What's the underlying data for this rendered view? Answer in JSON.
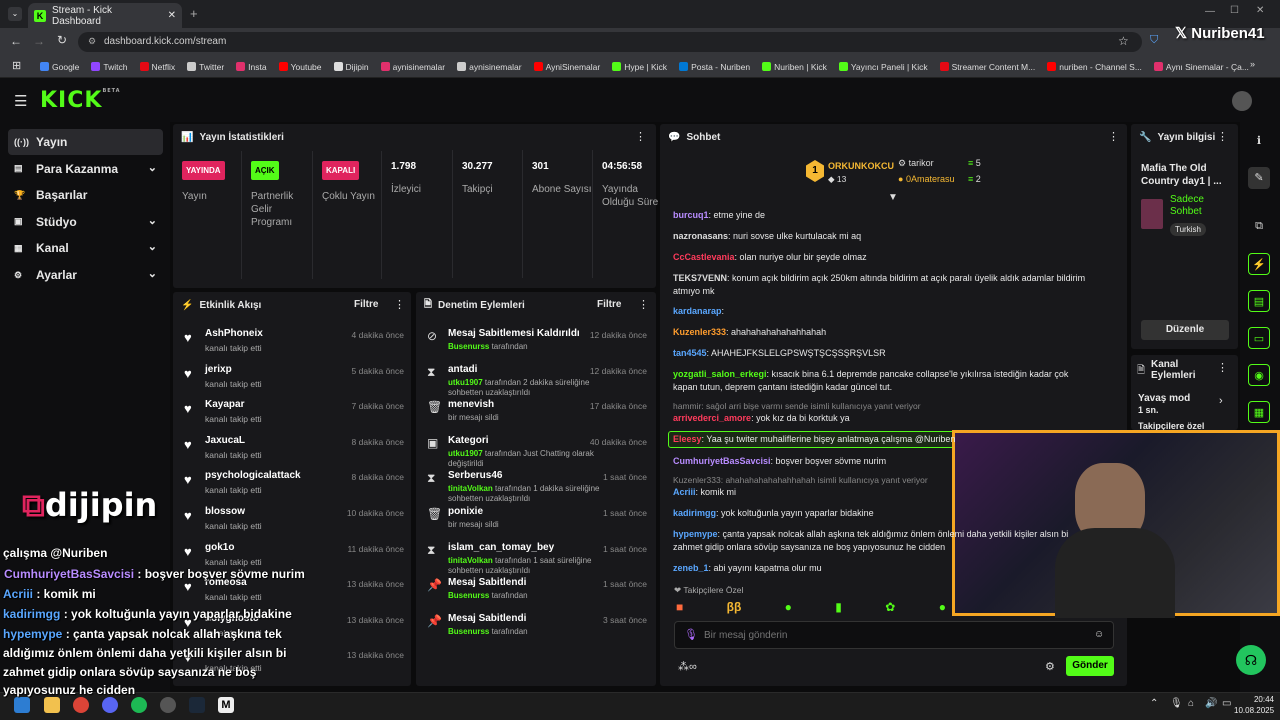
{
  "browser": {
    "tab_title": "Stream - Kick Dashboard",
    "url": "dashboard.kick.com/stream"
  },
  "bookmarks": [
    {
      "label": "Google",
      "color": "#4285f4"
    },
    {
      "label": "Twitch",
      "color": "#9146ff"
    },
    {
      "label": "Netflix",
      "color": "#e50914"
    },
    {
      "label": "Twitter",
      "color": "#cccccc"
    },
    {
      "label": "Insta",
      "color": "#e1306c"
    },
    {
      "label": "Youtube",
      "color": "#ff0000"
    },
    {
      "label": "Dijipin",
      "color": "#dddddd"
    },
    {
      "label": "aynisinemalar",
      "color": "#e1306c"
    },
    {
      "label": "aynisinemalar",
      "color": "#cccccc"
    },
    {
      "label": "AyniSinemalar",
      "color": "#ff0000"
    },
    {
      "label": "Hype | Kick",
      "color": "#53fc18"
    },
    {
      "label": "Posta - Nuriben",
      "color": "#0078d4"
    },
    {
      "label": "Nuriben | Kick",
      "color": "#53fc18"
    },
    {
      "label": "Yayıncı Paneli | Kick",
      "color": "#53fc18"
    },
    {
      "label": "Streamer Content M...",
      "color": "#e50914"
    },
    {
      "label": "nuriben - Channel S...",
      "color": "#ff0000"
    },
    {
      "label": "Aynı Sinemalar - Ça...",
      "color": "#e1306c"
    }
  ],
  "kick": {
    "logo": "KICK",
    "beta": "BETA"
  },
  "sidebar": [
    {
      "label": "Yayın",
      "icon": "broadcast-icon",
      "chev": false
    },
    {
      "label": "Para Kazanma",
      "icon": "money-icon",
      "chev": true
    },
    {
      "label": "Başarılar",
      "icon": "trophy-icon",
      "chev": false
    },
    {
      "label": "Stüdyo",
      "icon": "studio-icon",
      "chev": true
    },
    {
      "label": "Kanal",
      "icon": "channel-icon",
      "chev": true
    },
    {
      "label": "Ayarlar",
      "icon": "gear-icon",
      "chev": true
    }
  ],
  "stats": {
    "title": "Yayın İstatistikleri",
    "items": [
      {
        "badge": "YAYINDA",
        "badge_color": "#e0245e",
        "label": "Yayın"
      },
      {
        "badge": "AÇIK",
        "badge_color": "#53fc18",
        "label": "Partnerlik Gelir Programı"
      },
      {
        "badge": "KAPALI",
        "badge_color": "#e0245e",
        "label": "Çoklu Yayın"
      },
      {
        "value": "1.798",
        "label": "İzleyici"
      },
      {
        "value": "30.277",
        "label": "Takipçi"
      },
      {
        "value": "301",
        "label": "Abone Sayısı"
      },
      {
        "value": "04:56:58",
        "label": "Yayında Olduğu Süre"
      }
    ]
  },
  "activity": {
    "title": "Etkinlik Akışı",
    "filter": "Filtre",
    "items": [
      {
        "name": "AshPhoneix",
        "sub": "kanalı takip etti",
        "time": "4 dakika önce"
      },
      {
        "name": "jerixp",
        "sub": "kanalı takip etti",
        "time": "5 dakika önce"
      },
      {
        "name": "Kayapar",
        "sub": "kanalı takip etti",
        "time": "7 dakika önce"
      },
      {
        "name": "JaxucaL",
        "sub": "kanalı takip etti",
        "time": "8 dakika önce"
      },
      {
        "name": "psychologicalattack",
        "sub": "kanalı takip etti",
        "time": "8 dakika önce"
      },
      {
        "name": "blossow",
        "sub": "kanalı takip etti",
        "time": "10 dakika önce"
      },
      {
        "name": "gok1o",
        "sub": "kanalı takip etti",
        "time": "11 dakika önce"
      },
      {
        "name": "romeosa",
        "sub": "kanalı takip etti",
        "time": "13 dakika önce"
      },
      {
        "name": "holyghosto",
        "sub": "kanalı takip etti",
        "time": "13 dakika önce"
      },
      {
        "name": "",
        "sub": "kanalı takip etti",
        "time": "13 dakika önce"
      }
    ]
  },
  "moderation": {
    "title": "Denetim Eylemleri",
    "filter": "Filtre",
    "items": [
      {
        "icon": "unpin-icon",
        "title": "Mesaj Sabitlemesi Kaldırıldı",
        "user": "Busenurss",
        "rest": " tarafından",
        "time": "12 dakika önce"
      },
      {
        "icon": "timeout-icon",
        "title": "antadi",
        "user": "utku1907",
        "rest": " tarafından 2 dakika süreliğine sohbetten uzaklaştırıldı",
        "time": "12 dakika önce"
      },
      {
        "icon": "trash-icon",
        "title": "menevish",
        "user": "",
        "rest": "bir mesajı sildi",
        "time": "17 dakika önce"
      },
      {
        "icon": "category-icon",
        "title": "Kategori",
        "user": "utku1907",
        "rest": " tarafından Just Chatting olarak değiştirildi",
        "time": "40 dakika önce"
      },
      {
        "icon": "timeout-icon",
        "title": "Serberus46",
        "user": "tinitaVolkan",
        "rest": " tarafından 1 dakika süreliğine sohbetten uzaklaştırıldı",
        "time": "1 saat önce"
      },
      {
        "icon": "trash-icon",
        "title": "ponixie",
        "user": "",
        "rest": "bir mesajı sildi",
        "time": "1 saat önce"
      },
      {
        "icon": "timeout-icon",
        "title": "islam_can_tomay_bey",
        "user": "tinitaVolkan",
        "rest": " tarafından 1 saat süreliğine sohbetten uzaklaştırıldı",
        "time": "1 saat önce"
      },
      {
        "icon": "pin-icon",
        "title": "Mesaj Sabitlendi",
        "user": "Busenurss",
        "rest": " tarafından",
        "time": "1 saat önce"
      },
      {
        "icon": "pin-icon",
        "title": "Mesaj Sabitlendi",
        "user": "Busenurss",
        "rest": " tarafından",
        "time": "3 saat önce"
      }
    ]
  },
  "chat": {
    "title": "Sohbet",
    "leaders": [
      {
        "rank": "1",
        "name": "ORKUNKOKCU",
        "count": "13"
      },
      {
        "name": "tarikor",
        "count": "5"
      },
      {
        "name": "0Amaterasu",
        "count": "2"
      }
    ],
    "messages": [
      {
        "user": "burcuq1",
        "color": "#b88cff",
        "text": ": etme yine de"
      },
      {
        "user": "nazronasans",
        "color": "#dddddd",
        "text": ": nuri sovse ulke kurtulacak mi aq"
      },
      {
        "user": "CcCastlevania",
        "color": "#ff3b5c",
        "text": ": olan nuriye olur bir şeyde olmaz"
      },
      {
        "user": "TEKS7VENN",
        "color": "#dddddd",
        "text": ": konum açık bildirim açık 250km altında bildirim at açık paralı üyelik aldık adamlar bildirim atmıyo mk"
      },
      {
        "user": "kardanarap",
        "color": "#5aa7ff",
        "text": ":"
      },
      {
        "user": "Kuzenler333",
        "color": "#ff9d2e",
        "text": ": ahahahahahahahhahah"
      },
      {
        "user": "tan4545",
        "color": "#5aa7ff",
        "text": ": AHAHEJFKSLELGPSWŞTŞCŞSŞRŞVLSR"
      },
      {
        "user": "yozgatli_salon_erkegi",
        "color": "#53fc18",
        "text": ": kısacık bina 6.1 depremde pancake collapse'le yıkılırsa istediğin kadar çok kapan tutun, deprem çantanı istediğin kadar güncel tut."
      },
      {
        "user": "arrivederci_amore",
        "color": "#ff3b5c",
        "text": ": yok kız da bi korktuk ya"
      },
      {
        "user": "Eleesy",
        "color": "#ff3b5c",
        "text": ": Yaa şu twiter muhaliflerine bişey anlatmaya çalışma @Nuriben"
      },
      {
        "user": "CumhuriyetBasSavcisi",
        "color": "#b88cff",
        "text": ": boşver boşver sövme nurim"
      },
      {
        "user": "Acriii",
        "color": "#5aa7ff",
        "text": ": komik mi"
      },
      {
        "user": "kadirimgg",
        "color": "#5aa7ff",
        "text": ": yok koltuğunla yayın yaparlar bidakine"
      },
      {
        "user": "hypemype",
        "color": "#5aa7ff",
        "text": ": çanta yapsak nolcak allah aşkına tek aldığımız önlem önlemi daha yetkili kişiler alsın bi zahmet gidip onlara sövüp saysanıza ne boş yapıyosunuz he cidden"
      },
      {
        "user": "zeneb_1",
        "color": "#5aa7ff",
        "text": ": abi yayını kapatma olur mu"
      }
    ],
    "replies": [
      "hammir: sağol arri bişe varmı sende isimli kullanıcıya yanıt veriyor",
      "Kuzenler333: ahahahahahahahhahah isimli kullanıcıya yanıt veriyor"
    ],
    "followers_only": "Takipçilere Özel",
    "placeholder": "Bir mesaj gönderin",
    "send": "Gönder"
  },
  "info": {
    "title": "Yayın bilgisi",
    "stream_title": "Mafia The Old Country day1 | ...",
    "chat_mode": "Sadece Sohbet",
    "language": "Turkish",
    "edit": "Düzenle"
  },
  "channel_actions": {
    "title": "Kanal Eylemleri",
    "slow_mode": "Yavaş mod",
    "slow_value": "1 sn.",
    "next": "Takipçilere özel"
  },
  "overlay": {
    "brand": "dijipin",
    "watermark": "Nuriben41",
    "lines": [
      {
        "user": "",
        "text": "çalışma @Nuriben"
      },
      {
        "user": "CumhuriyetBasSavcisi",
        "text": " : boşver boşver sövme nurim",
        "color": "#b88cff"
      },
      {
        "user": "Acriii",
        "text": " : komik mi",
        "color": "#5aa7ff"
      },
      {
        "user": "kadirimgg",
        "text": " : yok koltuğunla yayın yaparlar bidakine",
        "color": "#5aa7ff"
      },
      {
        "user": "hypemype",
        "text": " : çanta yapsak nolcak allah aşkına tek",
        "color": "#5aa7ff"
      },
      {
        "user": "",
        "text": "aldığımız önlem önlemi daha yetkili kişiler alsın bi"
      },
      {
        "user": "",
        "text": "zahmet gidip onlara sövüp saysanıza ne boş"
      },
      {
        "user": "",
        "text": "yapıyosunuz he cidden"
      }
    ]
  },
  "taskbar": {
    "time": "20:44",
    "date": "10.08.2025"
  }
}
